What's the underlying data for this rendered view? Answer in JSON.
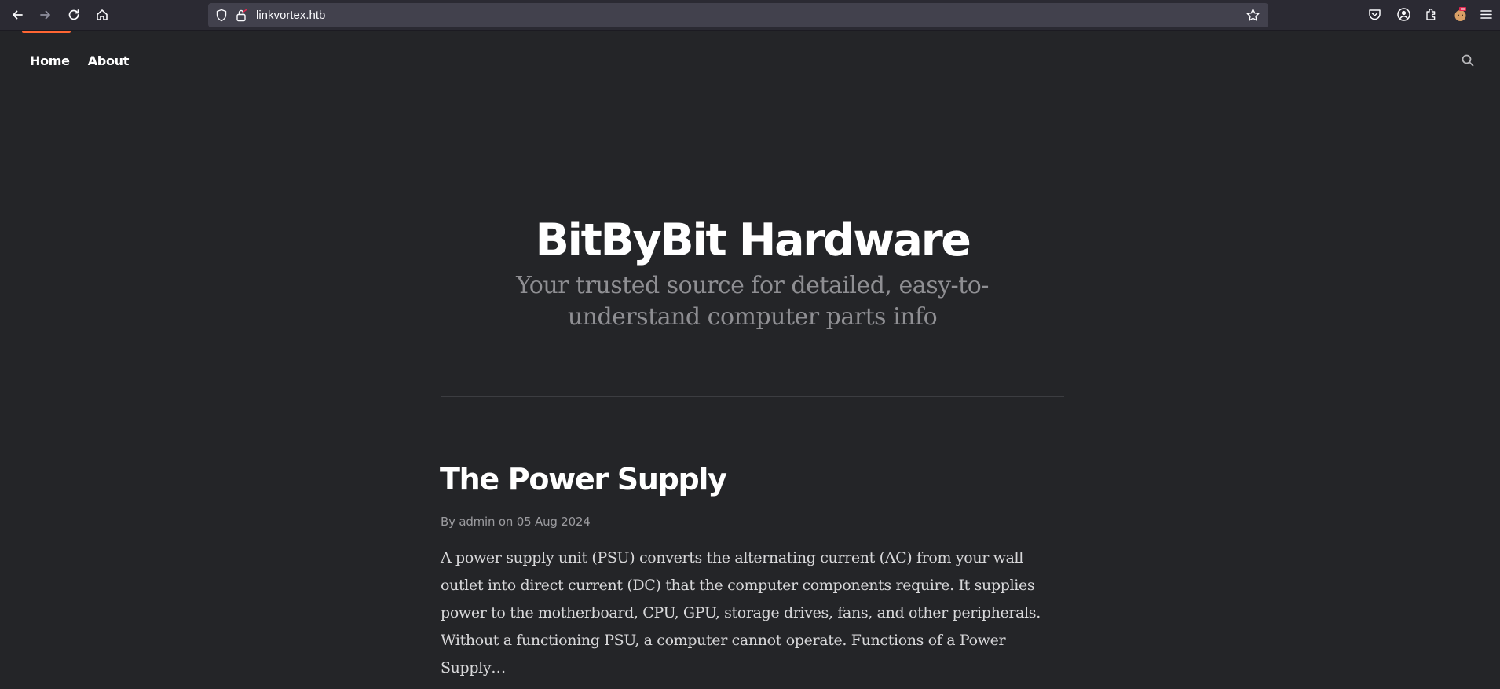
{
  "browser": {
    "url": "linkvortex.htb",
    "icons": {
      "back": "back-arrow-icon",
      "forward": "forward-arrow-icon",
      "reload": "reload-icon",
      "home": "home-icon",
      "shield": "tracking-protection-shield-icon",
      "lock": "lock-icon",
      "bookmark": "bookmark-star-icon",
      "pocket": "pocket-icon",
      "account": "account-icon",
      "extensions": "extensions-icon",
      "profile": "profile-avatar-icon",
      "menu": "hamburger-menu-icon"
    },
    "accent_color": "#ff6633"
  },
  "site": {
    "nav": [
      {
        "label": "Home"
      },
      {
        "label": "About"
      }
    ],
    "search_icon": "search-icon",
    "title": "BitByBit Hardware",
    "description": "Your trusted source for detailed, easy-to-understand computer parts info",
    "background_color": "#242528"
  },
  "posts": [
    {
      "title": "The Power Supply",
      "meta": "By admin on 05 Aug 2024",
      "excerpt": "A power supply unit (PSU) converts the alternating current (AC) from your wall outlet into direct current (DC) that the computer components require. It supplies power to the motherboard, CPU, GPU, storage drives, fans, and other peripherals. Without a functioning PSU, a computer cannot operate. Functions of a Power Supply…"
    }
  ]
}
